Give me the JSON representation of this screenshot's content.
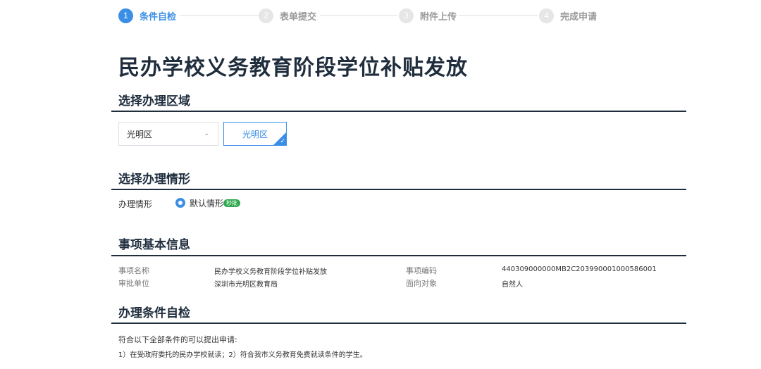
{
  "steps": [
    {
      "number": "1",
      "label": "条件自检",
      "active": true
    },
    {
      "number": "2",
      "label": "表单提交",
      "active": false
    },
    {
      "number": "3",
      "label": "附件上传",
      "active": false
    },
    {
      "number": "4",
      "label": "完成申请",
      "active": false
    }
  ],
  "page_title": "民办学校义务教育阶段学位补贴发放",
  "region_section": {
    "title": "选择办理区域",
    "select_value": "光明区",
    "selected_tag": "光明区"
  },
  "situation_section": {
    "title": "选择办理情形",
    "label": "办理情形",
    "option": "默认情形",
    "badge": "秒批"
  },
  "info_section": {
    "title": "事项基本信息",
    "items": [
      {
        "key": "事项名称",
        "value": "民办学校义务教育阶段学位补贴发放"
      },
      {
        "key": "事项编码",
        "value": "440309000000MB2C203990001000586001"
      },
      {
        "key": "审批单位",
        "value": "深圳市光明区教育局"
      },
      {
        "key": "面向对象",
        "value": "自然人"
      }
    ]
  },
  "condition_section": {
    "title": "办理条件自检",
    "intro": "符合以下全部条件的可以提出申请:",
    "text": "1）在受政府委托的民办学校就读；2）符合我市义务教育免费就读条件的学生。"
  },
  "colors": {
    "accent": "#3a8ee6",
    "badge": "#2fa84f",
    "heading": "#1f2d3d"
  }
}
